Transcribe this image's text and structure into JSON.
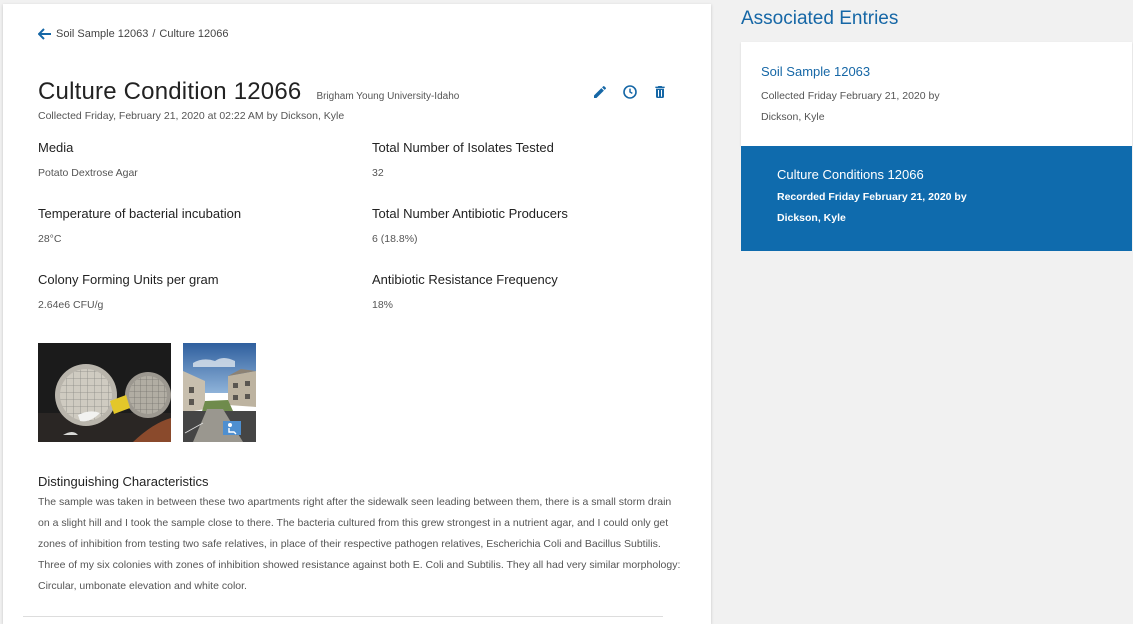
{
  "breadcrumb": {
    "parent": "Soil Sample 12063",
    "separator": "/",
    "current": "Culture 12066"
  },
  "header": {
    "title": "Culture Condition 12066",
    "institution": "Brigham Young University-Idaho",
    "collected": "Collected Friday, February 21, 2020 at 02:22 AM by Dickson, Kyle"
  },
  "actions": {
    "edit_icon": "pencil-icon",
    "history_icon": "clock-icon",
    "delete_icon": "trash-icon"
  },
  "fields": {
    "media": {
      "label": "Media",
      "value": "Potato Dextrose Agar"
    },
    "isolates": {
      "label": "Total Number of Isolates Tested",
      "value": "32"
    },
    "temperature": {
      "label": "Temperature of bacterial incubation",
      "value": "28°C"
    },
    "producers": {
      "label": "Total Number Antibiotic Producers",
      "value": "6 (18.8%)"
    },
    "cfu": {
      "label": "Colony Forming Units per gram",
      "value": "2.64e6 CFU/g"
    },
    "resistance": {
      "label": "Antibiotic Resistance Frequency",
      "value": "18%"
    }
  },
  "distinguishing": {
    "label": "Distinguishing Characteristics",
    "text": "The sample was taken in between these two apartments right after the sidewalk seen leading between them, there is a small storm drain on a slight hill and I took the sample close to there. The bacteria cultured from this grew strongest in a nutrient agar, and I could only get zones of inhibition from testing two safe relatives, in place of their respective pathogen relatives, Escherichia Coli and Bacillus Subtilis. Three of my six colonies with zones of inhibition showed resistance against both E. Coli and Subtilis. They all had very similar morphology: Circular, umbonate elevation and white color."
  },
  "associated": {
    "heading": "Associated Entries",
    "soil": {
      "title": "Soil Sample 12063",
      "subtitle": "Collected Friday February 21, 2020 by Dickson, Kyle"
    },
    "culture": {
      "title": "Culture Conditions 12066",
      "subtitle": "Recorded Friday February 21, 2020 by Dickson, Kyle"
    }
  },
  "colors": {
    "accent": "#1667a6",
    "active_bg": "#0f6bad",
    "background": "#f1f1f1"
  }
}
